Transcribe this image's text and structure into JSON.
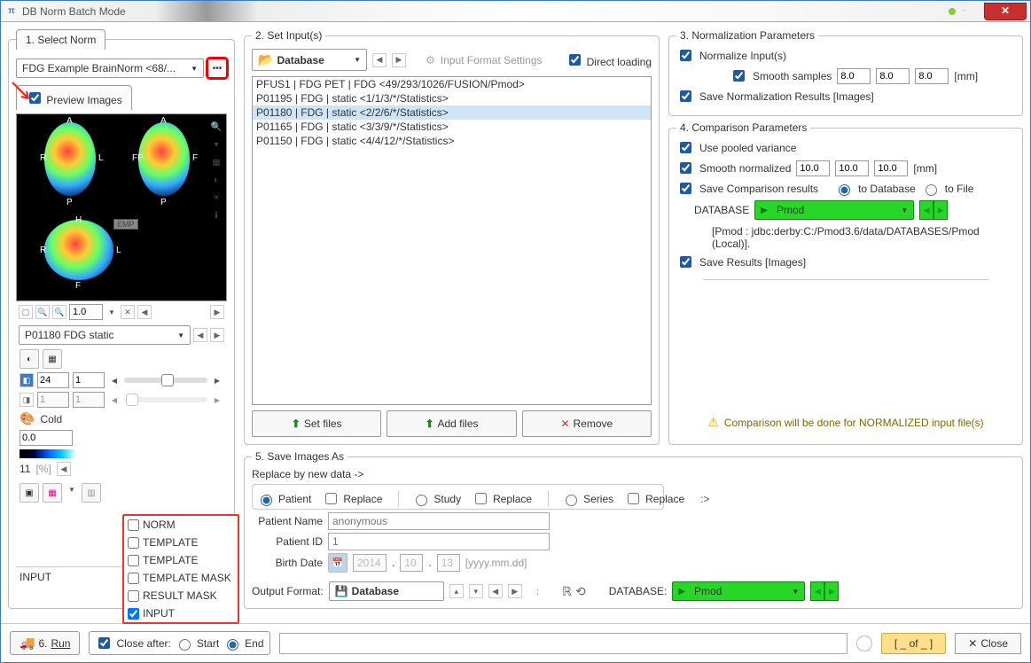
{
  "window": {
    "title": "DB Norm Batch Mode"
  },
  "panel1": {
    "legend": "1. Select Norm",
    "norm_name": "FDG Example BrainNorm <68/...",
    "preview_tab": "Preview Images",
    "emp": "EMP",
    "zoom_val": "1.0",
    "selected_image": "P01180 FDG static",
    "slider1_a": "24",
    "slider1_b": "1",
    "slider2_a": "1",
    "slider2_b": "1",
    "color_name": "Cold",
    "zero_val": "0.0",
    "scale_num": "11",
    "scale_unit": "[%]",
    "input_label": "INPUT",
    "menu": {
      "norm": "NORM",
      "tpl1": "TEMPLATE",
      "tpl2": "TEMPLATE",
      "tplmask": "TEMPLATE MASK",
      "resmask": "RESULT MASK",
      "input": "INPUT"
    },
    "axis": {
      "A": "A",
      "P": "P",
      "R": "R",
      "L": "L",
      "F": "F",
      "H": "H",
      "FP": "FP"
    }
  },
  "panel2": {
    "legend": "2. Set Input(s)",
    "source": "Database",
    "fmt_label": "Input Format Settings",
    "direct_loading": "Direct loading",
    "items": [
      "PFUS1 | FDG PET | FDG <49/293/1026/FUSION/Pmod>",
      "P01195 | FDG | static <1/1/3/*/Statistics>",
      "P01180 | FDG | static <2/2/6/*/Statistics>",
      "P01165 | FDG | static <3/3/9/*/Statistics>",
      "P01150 | FDG | static <4/4/12/*/Statistics>"
    ],
    "set_files": "Set files",
    "add_files": "Add files",
    "remove": "Remove"
  },
  "panel3": {
    "legend": "3. Normalization Parameters",
    "normalize": "Normalize Input(s)",
    "smooth_cb": "Smooth samples",
    "s1": "8.0",
    "s2": "8.0",
    "s3": "8.0",
    "s_unit": "[mm]",
    "save_norm": "Save Normalization Results [Images]"
  },
  "panel4": {
    "legend": "4. Comparison Parameters",
    "pooled": "Use pooled variance",
    "smoothn_label": "Smooth normalized",
    "sn1": "10.0",
    "sn2": "10.0",
    "sn3": "10.0",
    "sn_unit": "[mm]",
    "save_comp": "Save Comparison results",
    "toDB": "to Database",
    "toFile": "to File",
    "db_label": "DATABASE",
    "db_name": "Pmod",
    "db_path": "[Pmod : jdbc:derby:C:/Pmod3.6/data/DATABASES/Pmod (Local)].",
    "save_res": "Save Results [Images]",
    "warn": "Comparison will be done for NORMALIZED input file(s)"
  },
  "panel5": {
    "legend": "5. Save Images As",
    "replace_by": "Replace by new data ->",
    "patient": "Patient",
    "study": "Study",
    "series": "Series",
    "replace": "Replace",
    "pname_lbl": "Patient Name",
    "pname_ph": "anonymous",
    "pid_lbl": "Patient ID",
    "pid_ph": "1",
    "bdate_lbl": "Birth Date",
    "yr": "2014",
    "mo": "10",
    "dy": "13",
    "bdate_hint": "[yyyy.mm.dd]",
    "ofmt_lbl": "Output Format:",
    "ofmt_val": "Database",
    "db_label": "DATABASE:",
    "db_name": "Pmod"
  },
  "footer": {
    "run": "Run",
    "run_num": "6.",
    "close_after": "Close after:",
    "start": "Start",
    "end": "End",
    "of": "[ _ of _ ]",
    "close": "Close"
  }
}
